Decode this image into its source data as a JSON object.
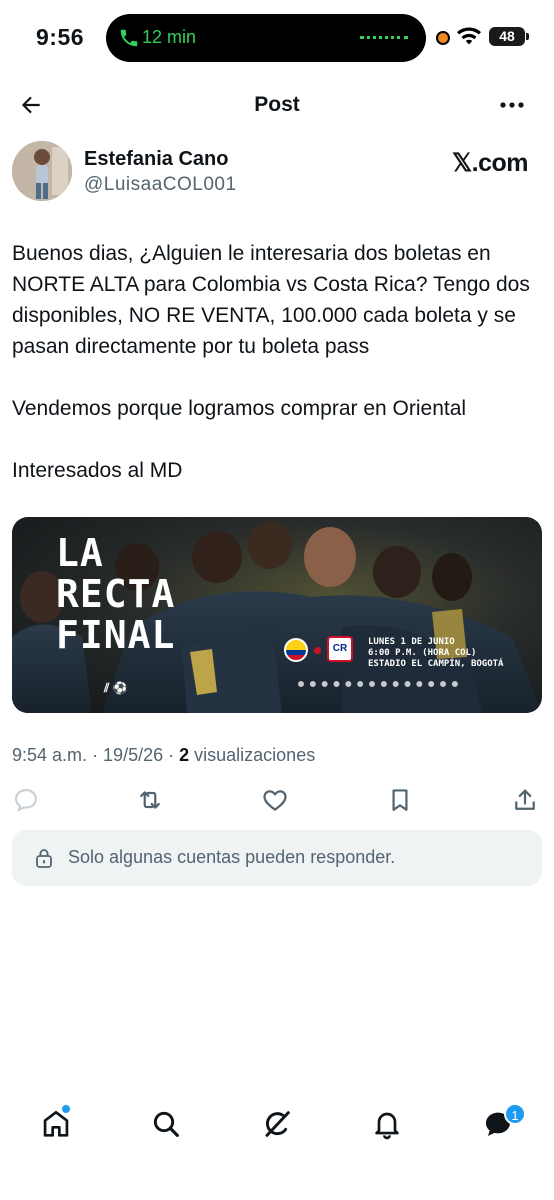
{
  "status_bar": {
    "time": "9:56",
    "call_duration": "12 min",
    "battery_level": "48",
    "call_color": "#35d05a",
    "recording_color": "#f08a24"
  },
  "header": {
    "title": "Post",
    "back_icon": "arrow-left-icon",
    "more_icon": "more-dots-icon"
  },
  "post": {
    "author_name": "Estefania Cano",
    "author_handle": "@LuisaaCOL001",
    "source": "𝕏.com",
    "text": {
      "paragraph_1": "Buenos dias, ¿Alguien le interesaria dos boletas en NORTE ALTA para Colombia vs Costa Rica? Tengo dos disponibles, NO RE VENTA, 100.000 cada boleta y se pasan directamente por tu boleta pass",
      "paragraph_2": "Vendemos porque logramos comprar en Oriental",
      "paragraph_3": "Interesados al MD"
    },
    "image": {
      "title_line_1": "LA",
      "title_line_2": "RECTA",
      "title_line_3": "FINAL",
      "info_line_1": "LUNES 1 DE JUNIO",
      "info_line_2": "6:00 P.M. (HORA COL)",
      "info_line_3": "ESTADIO EL CAMPÍN, BOGOTÁ",
      "badge_text": "CR"
    },
    "meta": {
      "time": "9:54 a.m.",
      "separator": " · ",
      "date": "19/5/26",
      "views_count": "2",
      "views_label": "visualizaciones"
    },
    "reply_restriction": "Solo algunas cuentas pueden responder."
  },
  "actions": [
    "reply-icon",
    "repost-icon",
    "like-icon",
    "bookmark-icon",
    "share-icon"
  ],
  "tabbar": {
    "tabs": [
      "home-icon",
      "search-icon",
      "grok-icon",
      "notifications-icon",
      "messages-icon"
    ],
    "messages_badge": "1",
    "accent_color": "#1d9bf0"
  }
}
